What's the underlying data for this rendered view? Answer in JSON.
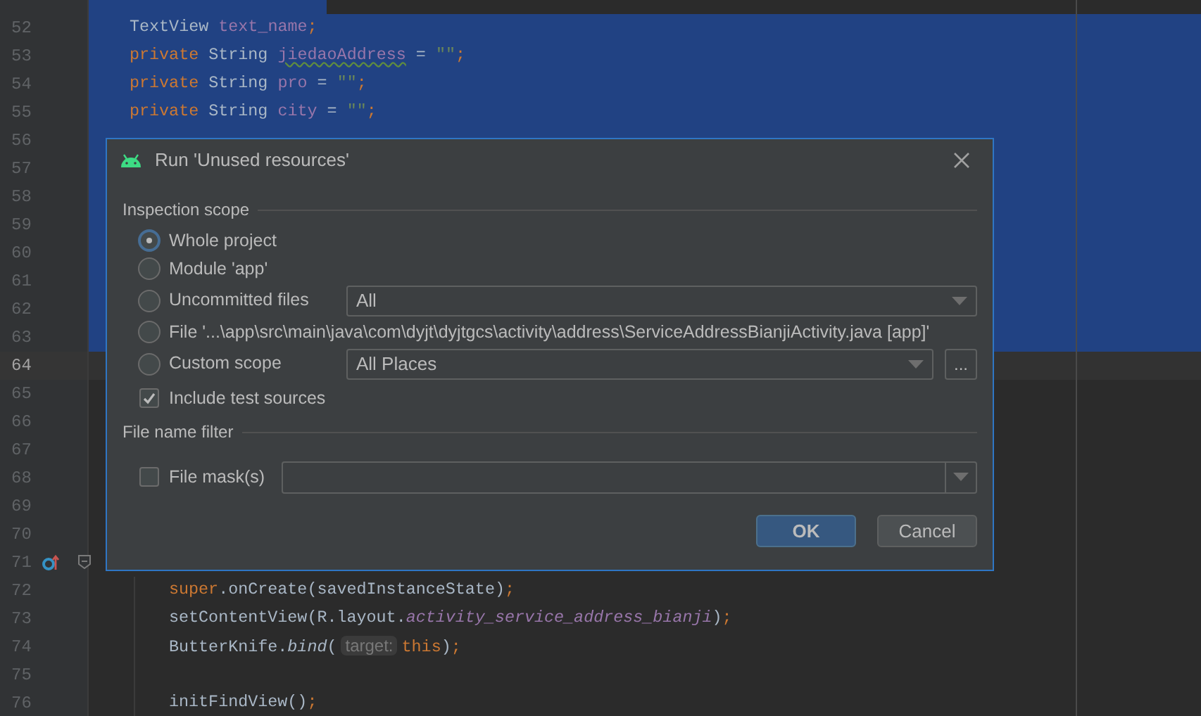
{
  "editor": {
    "lines": [
      {
        "selected": true,
        "full_width": false,
        "current": false
      },
      {
        "number": "52",
        "selected": true,
        "full_width": true,
        "current": false,
        "code": [
          {
            "text": "TextView ",
            "kind": "plain"
          },
          {
            "text": "text_name",
            "kind": "field"
          },
          {
            "text": ";",
            "kind": "keyword"
          }
        ]
      },
      {
        "number": "53",
        "selected": true,
        "full_width": true,
        "current": false,
        "code": [
          {
            "text": "private ",
            "kind": "keyword"
          },
          {
            "text": "String ",
            "kind": "plain"
          },
          {
            "text": "jiedaoAddress",
            "kind": "field_typo"
          },
          {
            "text": " = ",
            "kind": "plain"
          },
          {
            "text": "\"\"",
            "kind": "string"
          },
          {
            "text": ";",
            "kind": "keyword"
          }
        ]
      },
      {
        "number": "54",
        "selected": true,
        "full_width": true,
        "current": false,
        "code": [
          {
            "text": "private ",
            "kind": "keyword"
          },
          {
            "text": "String ",
            "kind": "plain"
          },
          {
            "text": "pro",
            "kind": "field"
          },
          {
            "text": " = ",
            "kind": "plain"
          },
          {
            "text": "\"\"",
            "kind": "string"
          },
          {
            "text": ";",
            "kind": "keyword"
          }
        ]
      },
      {
        "number": "55",
        "selected": true,
        "full_width": true,
        "current": false,
        "code": [
          {
            "text": "private ",
            "kind": "keyword"
          },
          {
            "text": "String ",
            "kind": "plain"
          },
          {
            "text": "city",
            "kind": "field"
          },
          {
            "text": " = ",
            "kind": "plain"
          },
          {
            "text": "\"\"",
            "kind": "string"
          },
          {
            "text": ";",
            "kind": "keyword"
          }
        ]
      },
      {
        "number": "56",
        "selected": true,
        "full_width": true,
        "current": false
      },
      {
        "number": "57",
        "selected": true,
        "full_width": true,
        "current": false
      },
      {
        "number": "58",
        "selected": true,
        "full_width": true,
        "current": false
      },
      {
        "number": "59",
        "selected": true,
        "full_width": true,
        "current": false
      },
      {
        "number": "60",
        "selected": true,
        "full_width": true,
        "current": false
      },
      {
        "number": "61",
        "selected": true,
        "full_width": true,
        "current": false
      },
      {
        "number": "62",
        "selected": true,
        "full_width": true,
        "current": false
      },
      {
        "number": "63",
        "selected": true,
        "full_width": true,
        "current": false
      },
      {
        "number": "64",
        "selected": false,
        "current": true
      },
      {
        "number": "65",
        "selected": false,
        "current": false
      },
      {
        "number": "66",
        "selected": false,
        "current": false
      },
      {
        "number": "67",
        "selected": false,
        "current": false
      },
      {
        "number": "68",
        "selected": false,
        "current": false
      },
      {
        "number": "69",
        "selected": false,
        "current": false
      },
      {
        "number": "70",
        "selected": false,
        "current": false
      },
      {
        "number": "71",
        "selected": false,
        "current": false,
        "markers": [
          {
            "kind": "override"
          },
          {
            "kind": "fold"
          }
        ]
      },
      {
        "number": "72",
        "selected": false,
        "current": false,
        "code": [
          {
            "text": "super",
            "kind": "keyword"
          },
          {
            "text": ".onCreate(savedInstanceState)",
            "kind": "plain"
          },
          {
            "text": ";",
            "kind": "keyword"
          }
        ]
      },
      {
        "number": "73",
        "selected": false,
        "current": false,
        "code": [
          {
            "text": "setContentView(R.layout.",
            "kind": "plain"
          },
          {
            "text": "activity_service_address_bianji",
            "kind": "static_field"
          },
          {
            "text": ")",
            "kind": "plain"
          },
          {
            "text": ";",
            "kind": "keyword"
          }
        ]
      },
      {
        "number": "74",
        "selected": false,
        "current": false,
        "code": [
          {
            "text": "ButterKnife.",
            "kind": "plain"
          },
          {
            "text": "bind",
            "kind": "static_method"
          },
          {
            "text": "(",
            "kind": "plain"
          },
          {
            "text": "target:",
            "kind": "hint"
          },
          {
            "text": "this",
            "kind": "keyword"
          },
          {
            "text": ")",
            "kind": "plain"
          },
          {
            "text": ";",
            "kind": "keyword"
          }
        ]
      },
      {
        "number": "75",
        "selected": false,
        "current": false
      },
      {
        "number": "76",
        "selected": false,
        "current": false,
        "code": [
          {
            "text": "initFindView()",
            "kind": "plain"
          },
          {
            "text": ";",
            "kind": "keyword"
          }
        ]
      }
    ]
  },
  "dialog": {
    "title": "Run 'Unused resources'",
    "scope_section": "Inspection scope",
    "scope_options": [
      {
        "label": "Whole project",
        "selected": true
      },
      {
        "label": "Module 'app'",
        "selected": false
      },
      {
        "label": "Uncommitted files",
        "selected": false,
        "dropdown": "All"
      },
      {
        "label": "File '...\\app\\src\\main\\java\\com\\dyjt\\dyjtgcs\\activity\\address\\ServiceAddressBianjiActivity.java [app]'",
        "selected": false
      },
      {
        "label": "Custom scope",
        "selected": false,
        "dropdown": "All Places",
        "browse": "..."
      }
    ],
    "include_tests": {
      "label": "Include test sources",
      "checked": true
    },
    "filter_section": "File name filter",
    "file_mask": {
      "label": "File mask(s)",
      "checked": false
    },
    "buttons": [
      {
        "label": "OK",
        "default": true
      },
      {
        "label": "Cancel",
        "default": false
      }
    ]
  }
}
